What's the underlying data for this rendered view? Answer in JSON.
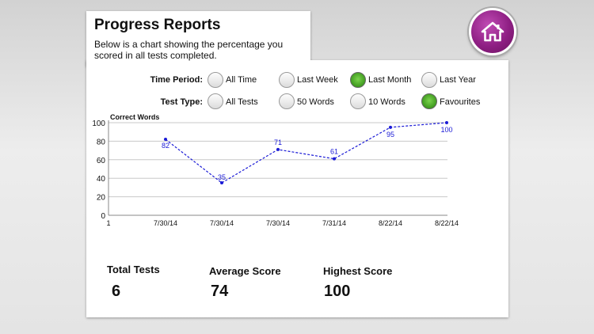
{
  "header": {
    "title": "Progress Reports",
    "subtitle": "Below is a chart showing the percentage you scored in all tests completed."
  },
  "home_button": {
    "icon": "home-icon",
    "color": "#8f1f84"
  },
  "filters": {
    "time_period": {
      "label": "Time Period:",
      "options": [
        "All Time",
        "Last Week",
        "Last Month",
        "Last Year"
      ],
      "selected": "Last Month"
    },
    "test_type": {
      "label": "Test Type:",
      "options": [
        "All Tests",
        "50 Words",
        "10 Words",
        "Favourites"
      ],
      "selected": "Favourites"
    }
  },
  "chart_data": {
    "type": "line",
    "ylabel": "Correct Words",
    "ylim": [
      0,
      100
    ],
    "yticks": [
      "0",
      "20",
      "40",
      "60",
      "80",
      "100"
    ],
    "x_origin_label": "1",
    "categories": [
      "7/30/14",
      "7/30/14",
      "7/30/14",
      "7/31/14",
      "8/22/14",
      "8/22/14"
    ],
    "values": [
      82,
      35,
      71,
      61,
      95,
      100
    ],
    "data_labels": [
      "82",
      "35",
      "71",
      "61",
      "95",
      "100"
    ],
    "line_color": "#1a1ad6",
    "grid": true
  },
  "stats": {
    "total_tests": {
      "label": "Total Tests",
      "value": "6"
    },
    "average_score": {
      "label": "Average Score",
      "value": "74"
    },
    "highest_score": {
      "label": "Highest Score",
      "value": "100"
    }
  }
}
